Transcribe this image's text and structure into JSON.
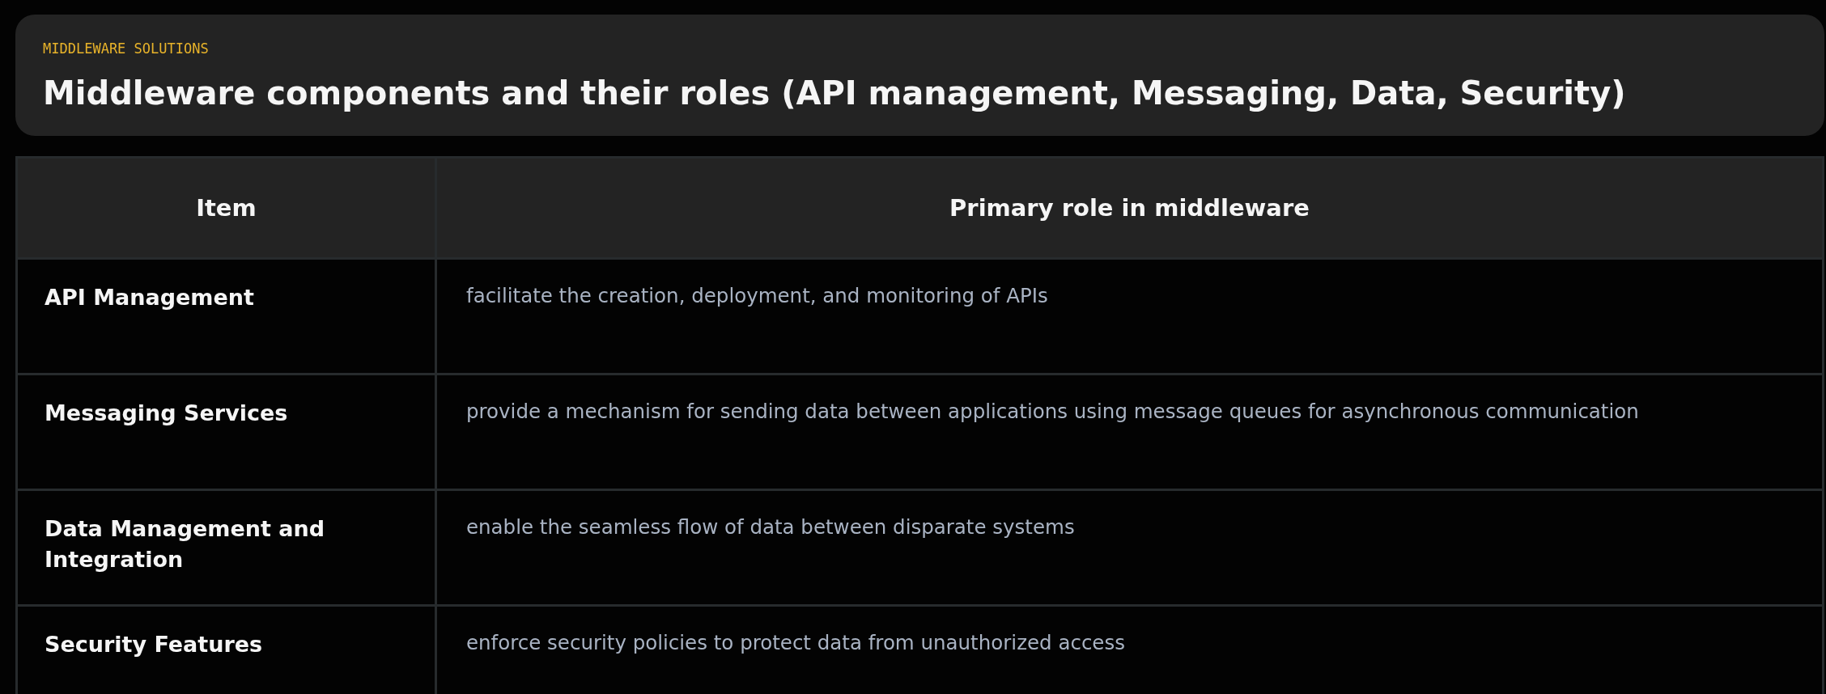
{
  "header": {
    "eyebrow": "MIDDLEWARE SOLUTIONS",
    "title": "Middleware components and their roles (API management, Messaging, Data, Security)"
  },
  "table": {
    "columns": [
      "Item",
      "Primary role in middleware"
    ],
    "rows": [
      {
        "item": "API Management",
        "role": "facilitate the creation, deployment, and monitoring of APIs"
      },
      {
        "item": "Messaging Services",
        "role": "provide a mechanism for sending data between applications using message queues for asynchronous communication"
      },
      {
        "item": "Data Management and Integration",
        "role": "enable the seamless flow of data between disparate systems"
      },
      {
        "item": "Security Features",
        "role": "enforce security policies to protect data from unauthorized access"
      }
    ]
  }
}
